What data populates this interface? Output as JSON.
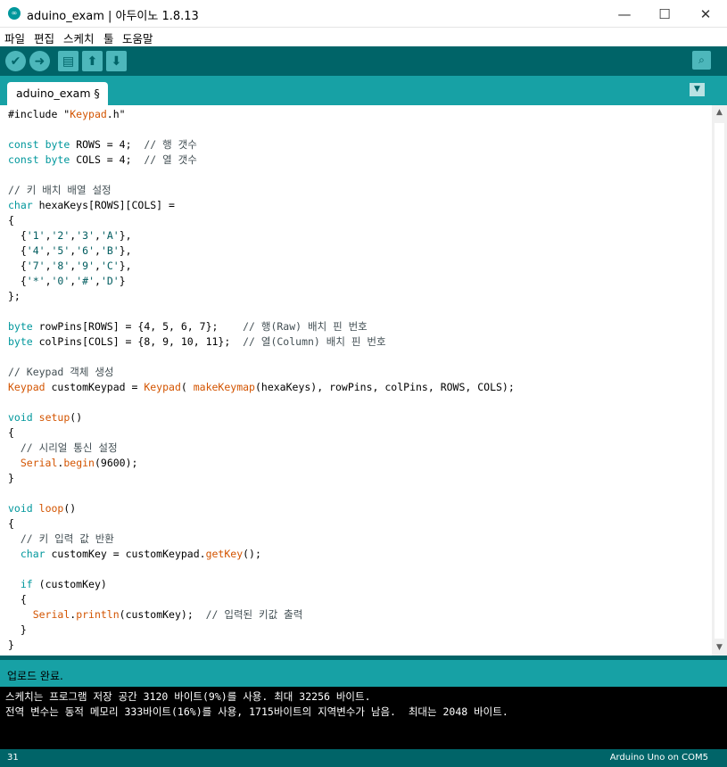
{
  "window": {
    "title": "aduino_exam | 아두이노 1.8.13",
    "app_icon": "arduino-logo-icon",
    "controls": {
      "minimize": "—",
      "maximize": "☐",
      "close": "✕"
    }
  },
  "menu": [
    "파일",
    "편집",
    "스케치",
    "툴",
    "도움말"
  ],
  "toolbar": {
    "buttons": [
      {
        "name": "verify",
        "icon": "check-icon",
        "glyph": "✔"
      },
      {
        "name": "upload",
        "icon": "arrow-right-icon",
        "glyph": "➜"
      },
      {
        "name": "new",
        "icon": "new-file-icon",
        "glyph": "▤"
      },
      {
        "name": "open",
        "icon": "arrow-up-icon",
        "glyph": "⬆"
      },
      {
        "name": "save",
        "icon": "arrow-down-icon",
        "glyph": "⬇"
      }
    ],
    "serial_monitor_icon": "serial-monitor-icon",
    "serial_monitor_glyph": "⌕"
  },
  "tabs": [
    {
      "label": "aduino_exam §"
    }
  ],
  "tab_menu_glyph": "▼",
  "editor": {
    "lines": [
      "#include \"Keypad.h\"",
      "",
      "const byte ROWS = 4;  // 행 갯수",
      "const byte COLS = 4;  // 열 갯수",
      "",
      "// 키 배치 배열 설정",
      "char hexaKeys[ROWS][COLS] =",
      "{",
      "  {'1','2','3','A'},",
      "  {'4','5','6','B'},",
      "  {'7','8','9','C'},",
      "  {'*','0','#','D'}",
      "};",
      "",
      "byte rowPins[ROWS] = {4, 5, 6, 7};    // 행(Raw) 배치 핀 번호",
      "byte colPins[COLS] = {8, 9, 10, 11};  // 열(Column) 배치 핀 번호",
      "",
      "// Keypad 객체 생성",
      "Keypad customKeypad = Keypad( makeKeymap(hexaKeys), rowPins, colPins, ROWS, COLS);",
      "",
      "void setup()",
      "{",
      "  // 시리얼 통신 설정",
      "  Serial.begin(9600);",
      "}",
      "",
      "void loop()",
      "{",
      "  // 키 입력 값 반환",
      "  char customKey = customKeypad.getKey();",
      "",
      "  if (customKey)",
      "  {",
      "    Serial.println(customKey);  // 입력된 키값 출력",
      "  }",
      "}"
    ]
  },
  "status": {
    "message": "업로드 완료."
  },
  "console": {
    "lines": [
      "스케치는 프로그램 저장 공간 3120 바이트(9%)를 사용. 최대 32256 바이트.",
      "전역 변수는 동적 메모리 333바이트(16%)를 사용, 1715바이트의 지역변수가 남음.  최대는 2048 바이트."
    ]
  },
  "footer": {
    "line_number": "31",
    "board": "Arduino Uno on COM5"
  },
  "colors": {
    "toolbar_bg": "#006468",
    "tabbar_bg": "#17a1a5",
    "keyword": "#00979c",
    "function": "#d35400",
    "comment": "#434f54",
    "console_bg": "#000000"
  }
}
